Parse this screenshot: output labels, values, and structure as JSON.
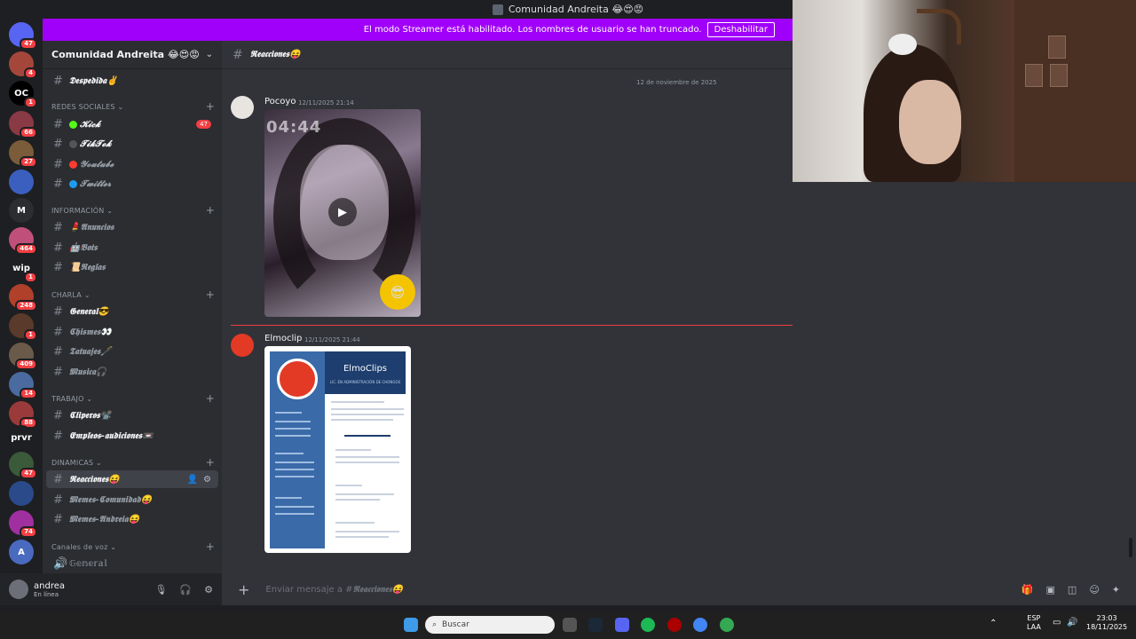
{
  "window": {
    "title": "Comunidad Andreita 😂😍😡"
  },
  "banner": {
    "text": "El modo Streamer está habilitado. Los nombres de usuario se han truncado.",
    "button": "Deshabilitar"
  },
  "rail": {
    "servers": [
      {
        "label": "",
        "badge": "47",
        "color": "#5865f2"
      },
      {
        "label": "",
        "badge": "4",
        "color": "#a4473a"
      },
      {
        "label": "OC",
        "badge": "1",
        "color": "#000000"
      },
      {
        "label": "",
        "badge": "66",
        "color": "#8a3a44"
      },
      {
        "label": "",
        "badge": "27",
        "color": "#7a5c3a"
      },
      {
        "label": "",
        "badge": "",
        "color": "#3b5fbf"
      },
      {
        "label": "M",
        "badge": "",
        "color": "#2b2d31"
      },
      {
        "label": "",
        "badge": "464",
        "color": "#c0507a"
      },
      {
        "label": "wip",
        "badge": "1",
        "color": "#1e1f22"
      },
      {
        "label": "",
        "badge": "248",
        "color": "#b0402a"
      },
      {
        "label": "",
        "badge": "1",
        "color": "#5a3a2a"
      },
      {
        "label": "",
        "badge": "409",
        "color": "#6a5a4a"
      },
      {
        "label": "",
        "badge": "14",
        "color": "#4a6aa0"
      },
      {
        "label": "",
        "badge": "88",
        "color": "#9a3a3a"
      },
      {
        "label": "prvr",
        "badge": "",
        "color": "#1e1f22"
      },
      {
        "label": "",
        "badge": "47",
        "color": "#3a5a3a"
      },
      {
        "label": "",
        "badge": "",
        "color": "#2a4a8a"
      },
      {
        "label": "",
        "badge": "74",
        "color": "#a030a0"
      },
      {
        "label": "A",
        "badge": "",
        "color": "#4a6ac0"
      }
    ]
  },
  "sidebar": {
    "guild_name": "Comunidad Andreita 😂😍😡",
    "top_channel": "𝕯𝖊𝖘𝖕𝖊𝖉𝖎𝖉𝖆✌️",
    "categories": {
      "redes": "REDES SOCIALES",
      "info": "INFORMACIÓN",
      "charla": "CHARLA",
      "trabajo": "TRABAJO",
      "dinamicas": "DINAMICAS",
      "voz": "Canales de voz"
    },
    "redes": [
      {
        "name": "𝓚𝓲𝓬𝓴",
        "dot": "#53fc18",
        "count": "47"
      },
      {
        "name": "𝓣𝓲𝓴𝓣𝓸𝓴",
        "dot": "#555555",
        "count": ""
      },
      {
        "name": "𝓨𝓸𝓾𝓽𝓾𝓫𝓮",
        "dot": "#ff3b30",
        "count": ""
      },
      {
        "name": "𝓣𝔀𝓲𝓽𝓽𝓮𝓻",
        "dot": "#1d9bf0",
        "count": ""
      }
    ],
    "info": [
      "💄𝕬𝖓𝖚𝖓𝖈𝖎𝖔𝖘",
      "🤖𝕭𝖔𝖙𝖘",
      "📜𝕽𝖊𝖌𝖑𝖆𝖘"
    ],
    "charla": [
      "𝕲𝖊𝖓𝖊𝖗𝖆𝖑😎",
      "𝕮𝖍𝖎𝖘𝖒𝖊𝖘👀",
      "𝕿𝖆𝖙𝖚𝖆𝖏𝖊𝖘🖋️",
      "𝕸𝖚𝖘𝖎𝖈𝖆🎧"
    ],
    "trabajo": [
      "𝕮𝖑𝖎𝖕𝖊𝖗𝖔𝖘📽️",
      "𝕰𝖒𝖕𝖑𝖊𝖔𝖘-𝖆𝖚𝖉𝖎𝖈𝖎𝖔𝖓𝖊𝖘📼"
    ],
    "dinamicas": [
      "𝕽𝖊𝖆𝖈𝖈𝖎𝖔𝖓𝖊𝖘😝",
      "𝕸𝖊𝖒𝖊𝖘-𝕮𝖔𝖒𝖚𝖓𝖎𝖉𝖆𝖉😝",
      "𝕸𝖊𝖒𝖊𝖘-𝕬𝖓𝖉𝖗𝖊𝖎𝖆😝"
    ],
    "voz": [
      "𝔾𝕖𝕟𝕖𝕣𝕒𝕝"
    ]
  },
  "user": {
    "name": "andrea",
    "status": "En línea"
  },
  "chat": {
    "channel": "𝕽𝖊𝖆𝖈𝖈𝖎𝖔𝖓𝖊𝖘😝",
    "date_divider": "12 de noviembre de 2025",
    "messages": [
      {
        "user": "Pocoyo",
        "time": "12/11/2025 21:14",
        "attachment": "video",
        "timecode": "04:44"
      },
      {
        "user": "Elmoclip",
        "time": "12/11/2025 21:44",
        "attachment": "image"
      }
    ],
    "cv": {
      "title": "ElmoClips",
      "subtitle": "LIC. EN ADMINISTRACIÓN DE CHONGOS"
    },
    "input_placeholder_prefix": "Enviar mensaje a #",
    "input_placeholder_channel": "𝕽𝖊𝖆𝖈𝖈𝖎𝖔𝖓𝖊𝖘😝"
  },
  "taskbar": {
    "search_placeholder": "Buscar",
    "lang": "ESP",
    "layout": "LAA",
    "time": "23:03",
    "date": "18/11/2025"
  }
}
